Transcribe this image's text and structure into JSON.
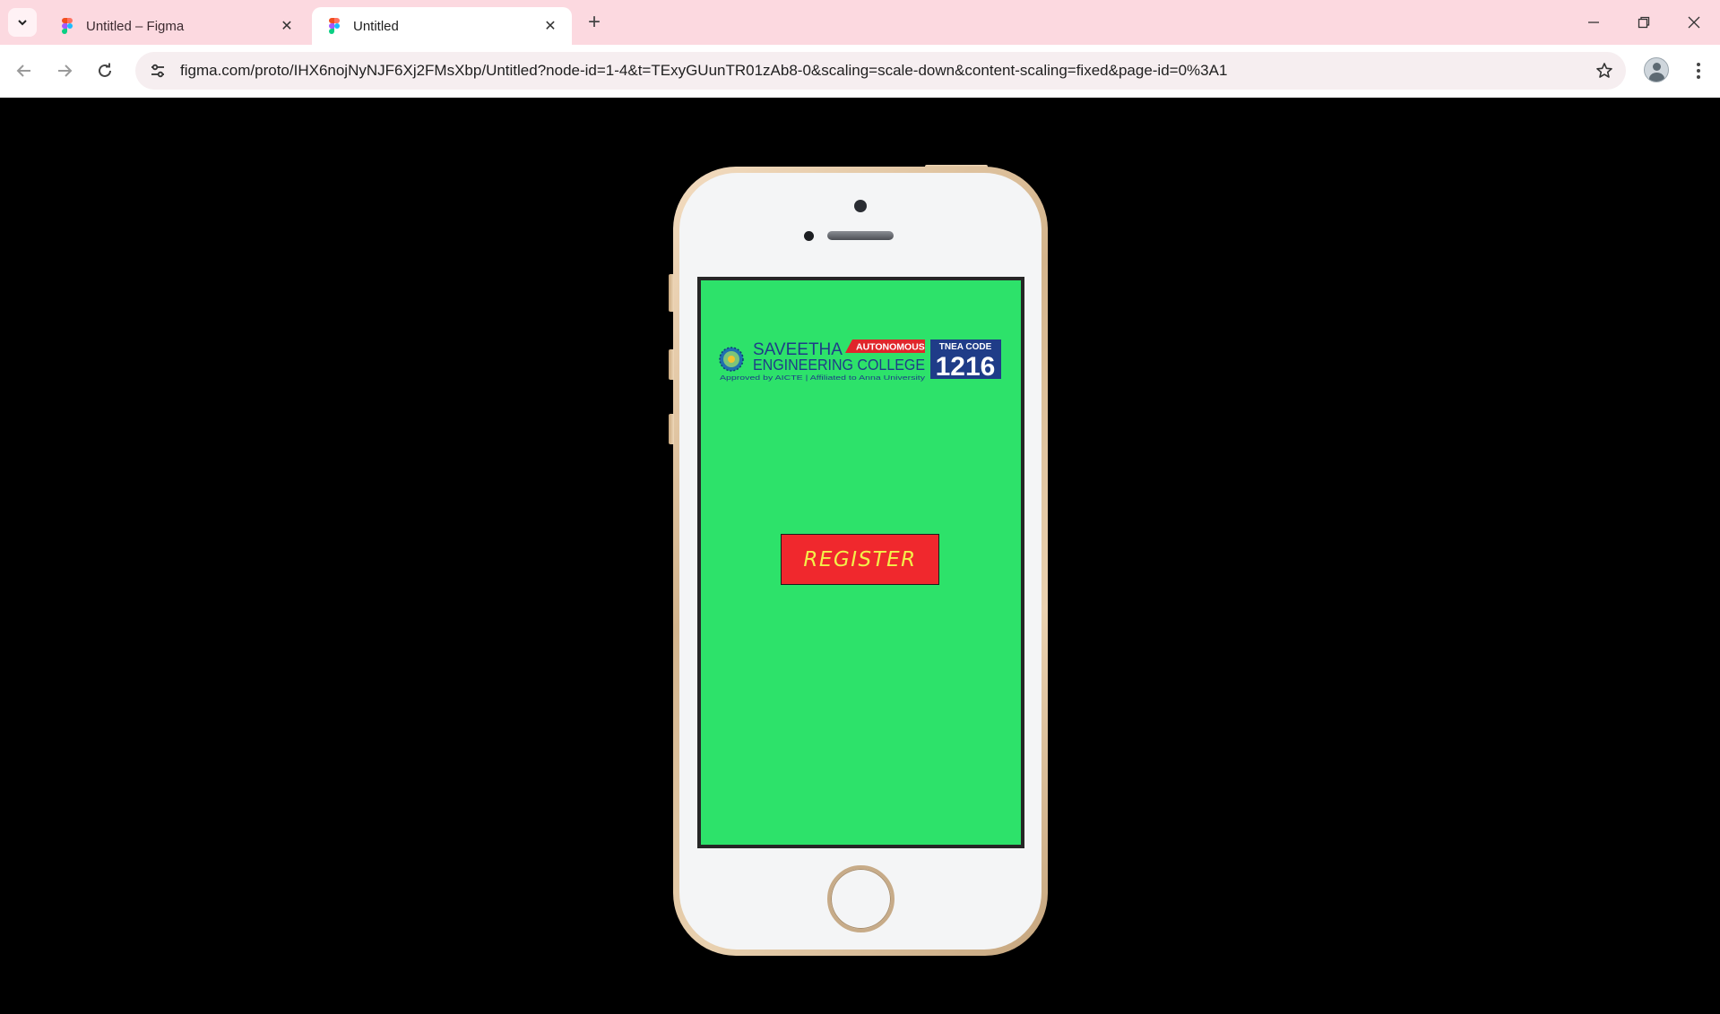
{
  "browser": {
    "tabs": [
      {
        "title": "Untitled – Figma",
        "active": false
      },
      {
        "title": "Untitled",
        "active": true
      }
    ],
    "url": "figma.com/proto/IHX6nojNyNJF6Xj2FMsXbp/Untitled?node-id=1-4&t=TExyGUunTR01zAb8-0&scaling=scale-down&content-scaling=fixed&page-id=0%3A1"
  },
  "prototype": {
    "logo": {
      "name_line1": "SAVEETHA",
      "name_line2": "ENGINEERING COLLEGE",
      "badge": "AUTONOMOUS",
      "tagline": "Approved by AICTE  |  Affiliated to Anna University",
      "code_label": "TNEA CODE",
      "code_value": "1216"
    },
    "register_label": "REGISTER"
  },
  "colors": {
    "tabstrip_bg": "#fcd9e0",
    "screen_bg": "#2de26a",
    "button_bg": "#f0282d",
    "button_text": "#f3f04a",
    "logo_blue": "#1f3c88",
    "logo_red": "#e0262b"
  },
  "icons": {
    "tab_search": "chevron-down-icon",
    "favicon": "figma-icon",
    "tab_close": "close-icon",
    "new_tab": "plus-icon",
    "back": "arrow-left-icon",
    "forward": "arrow-right-icon",
    "reload": "reload-icon",
    "site_info": "tune-icon",
    "bookmark": "star-icon",
    "menu": "kebab-menu-icon"
  }
}
